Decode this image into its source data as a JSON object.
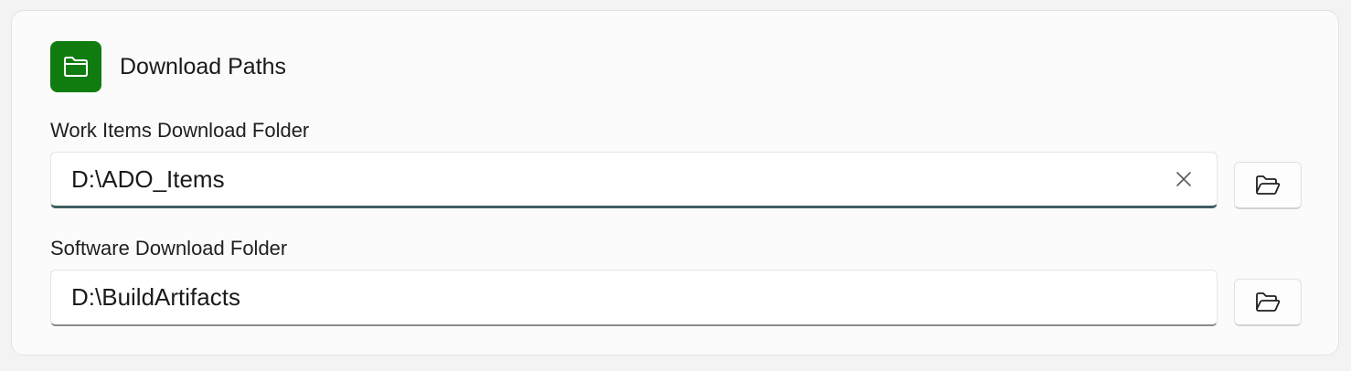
{
  "section": {
    "title": "Download Paths",
    "icon": "folder-icon",
    "accent_color": "#107c10"
  },
  "fields": [
    {
      "label": "Work Items Download Folder",
      "value": "D:\\ADO_Items",
      "focused": true,
      "clear_icon": "close-icon",
      "browse_icon": "folder-open-icon"
    },
    {
      "label": "Software Download Folder",
      "value": "D:\\BuildArtifacts",
      "focused": false,
      "browse_icon": "folder-open-icon"
    }
  ]
}
